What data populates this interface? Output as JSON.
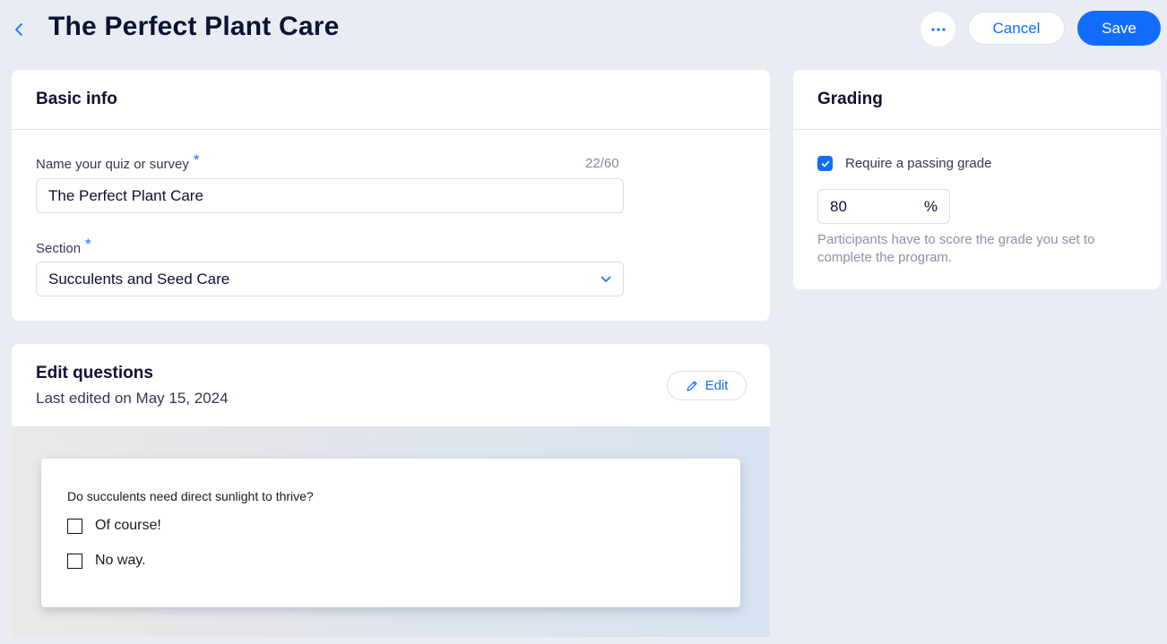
{
  "header": {
    "title": "The Perfect Plant Care",
    "back_icon": "chevron-left-icon",
    "more_icon": "ellipsis-icon",
    "cancel_label": "Cancel",
    "save_label": "Save"
  },
  "basic_info": {
    "title": "Basic info",
    "name_field": {
      "label": "Name your quiz or survey",
      "required_mark": "*",
      "counter": "22/60",
      "value": "The Perfect Plant Care"
    },
    "section_field": {
      "label": "Section",
      "required_mark": "*",
      "selected": "Succulents and Seed Care"
    }
  },
  "grading": {
    "title": "Grading",
    "require_passing_label": "Require a passing grade",
    "require_passing_checked": true,
    "passing_grade_value": "80",
    "passing_grade_unit": "%",
    "help_text": "Participants have to score the grade you set to complete the program."
  },
  "edit_questions": {
    "title": "Edit questions",
    "last_edited": "Last edited on May 15, 2024",
    "edit_label": "Edit",
    "preview": {
      "question": "Do succulents need direct sunlight to thrive?",
      "options": [
        "Of course!",
        "No way."
      ]
    }
  },
  "colors": {
    "accent": "#116dff",
    "background": "#e9edf3",
    "title_text": "#0b1233"
  }
}
